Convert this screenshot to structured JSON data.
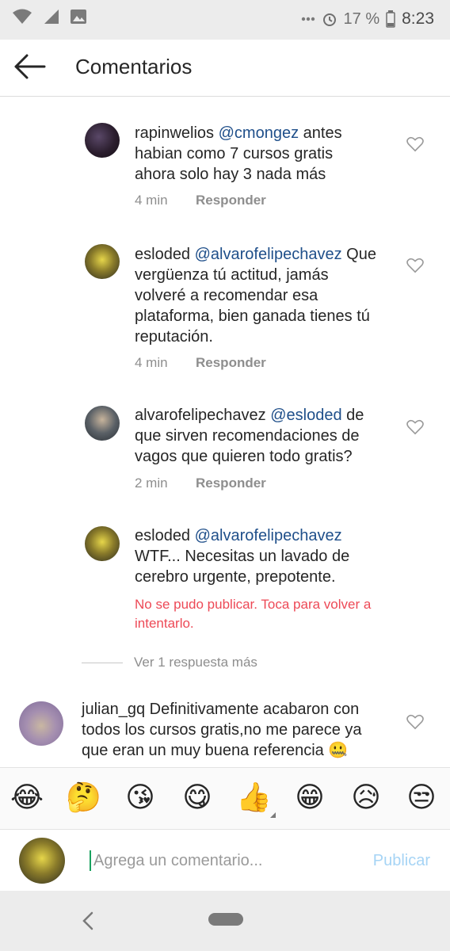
{
  "status_bar": {
    "alarm_icon": "alarm-icon",
    "battery_percent": "17 %",
    "time": "8:23",
    "icons": [
      "wifi-icon",
      "signal-icon",
      "image-icon",
      "more-dots-icon",
      "alarm-icon",
      "battery-icon"
    ]
  },
  "header": {
    "title": "Comentarios",
    "back_icon": "arrow-left-icon"
  },
  "comments": [
    {
      "username": "rapinwelios",
      "mention": "@cmongez",
      "text": " antes habian como 7 cursos gratis ahora solo hay 3 nada más",
      "time": "4 min",
      "reply_label": "Responder"
    },
    {
      "username": "esloded",
      "mention": "@alvarofelipechavez",
      "text": "Que vergüenza tú actitud, jamás volveré a recomendar esa plataforma, bien ganada tienes tú reputación.",
      "time": "4 min",
      "reply_label": "Responder"
    },
    {
      "username": "alvarofelipechavez",
      "mention": "@esloded",
      "text": " de que sirven recomendaciones de vagos que quieren todo gratis?",
      "time": "2 min",
      "reply_label": "Responder"
    },
    {
      "username": "esloded",
      "mention": "@alvarofelipechavez",
      "text": "WTF... Necesitas un lavado de cerebro urgente, prepotente.",
      "error": "No se pudo publicar. Toca para volver a intentarlo."
    },
    {
      "username": "julian_gq",
      "text": " Definitivamente acabaron con todos los cursos gratis,no me parece ya que eran un muy buena referencia 🤐"
    }
  ],
  "more_replies": "Ver 1 respuesta más",
  "emoji_bar": [
    "😂",
    "🤔",
    "😘",
    "😋",
    "👍",
    "😁",
    "😥",
    "😒"
  ],
  "composer": {
    "placeholder": "Agrega un comentario...",
    "publish_label": "Publicar"
  },
  "colors": {
    "mention": "#1f4f8a",
    "error": "#ed4956",
    "publish_disabled": "#a6d4f5",
    "meta_gray": "#8e8e8e"
  }
}
